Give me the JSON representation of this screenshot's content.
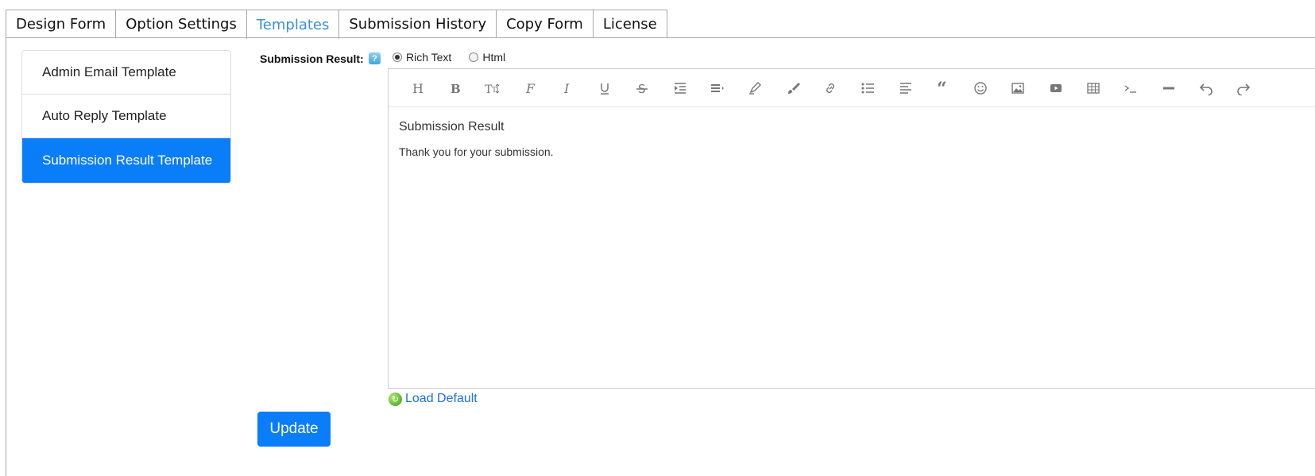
{
  "tabs": [
    {
      "label": "Design Form"
    },
    {
      "label": "Option Settings"
    },
    {
      "label": "Templates"
    },
    {
      "label": "Submission History"
    },
    {
      "label": "Copy Form"
    },
    {
      "label": "License"
    }
  ],
  "active_tab": "Templates",
  "templates": [
    {
      "label": "Admin Email Template"
    },
    {
      "label": "Auto Reply Template"
    },
    {
      "label": "Submission Result Template"
    }
  ],
  "field": {
    "label": "Submission Result:",
    "help_icon_glyph": "?",
    "formats": [
      {
        "label": "Rich Text",
        "checked": true
      },
      {
        "label": "Html",
        "checked": false
      }
    ]
  },
  "toolbar_icons": [
    "heading-icon",
    "bold-icon",
    "font-size-icon",
    "font-family-icon",
    "italic-icon",
    "underline-icon",
    "strikethrough-icon",
    "indent-icon",
    "line-height-icon",
    "highlight-icon",
    "paint-brush-icon",
    "link-icon",
    "unordered-list-icon",
    "align-left-icon",
    "quote-icon",
    "emoji-icon",
    "image-icon",
    "video-icon",
    "table-icon",
    "code-icon",
    "horizontal-rule-icon",
    "undo-icon",
    "redo-icon"
  ],
  "editor": {
    "heading": "Submission Result",
    "body": "Thank you for your submission."
  },
  "load_default_label": "Load Default",
  "update_label": "Update",
  "colors": {
    "accent": "#0a7df8",
    "tab_active": "#3a8fd6",
    "link": "#1a73d9"
  }
}
